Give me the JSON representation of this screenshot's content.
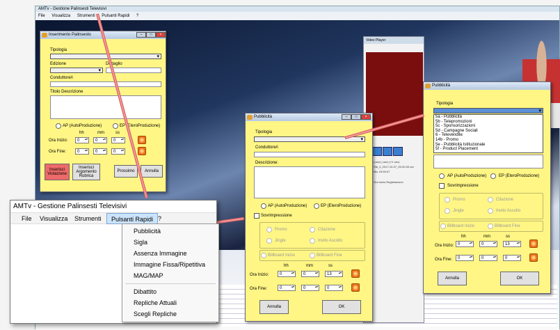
{
  "background_app": {
    "title": "AMTv - Gestione Palinsesti Televisivi",
    "menu": [
      "File",
      "Visualizza",
      "Strumenti",
      "Pulsanti Rapidi",
      "?"
    ]
  },
  "video_player": {
    "title": "Video Player",
    "info_line1": "Rai_3_2017-10-07_00-00-09.avi",
    "info_line2": "Ma: 23:59:47",
    "info_line3": "Ora Inizio Registrazione",
    "links": [
      "(-sec)",
      "(-sec)",
      "(+1 sec)"
    ]
  },
  "inserimento_window": {
    "title": "Inserimento Palinsesto",
    "tipologia_label": "Tipologia",
    "edizione_label": "Edizione",
    "dettaglio_label": "Dettaglio",
    "conduttore_label": "Conduttore/i",
    "titolo_label": "Titolo Descrizione",
    "radio_ap": "AP (AutoProduzione)",
    "radio_ep": "EP (EteroProduzione)",
    "hh": "hh",
    "mm": "mm",
    "ss": "ss",
    "ora_inizio": "Ora Inizio:",
    "ora_fine": "Ora Fine:",
    "time_zero": "0",
    "btn_violazione": "Inserisci Violazione",
    "btn_argomento": "Inserisci Argomento Rubrica",
    "btn_prossimo": "Prossimo",
    "btn_annulla": "Annulla"
  },
  "pubblicita_window": {
    "title": "Pubblicità",
    "tipologia_label": "Tipologia",
    "conduttore_label": "Conduttore/i",
    "descrizione_label": "Descrizione:",
    "radio_ap": "AP (AutoProduzione)",
    "radio_ep": "EP (EteroProduzione)",
    "sovrimpressione": "Sovrimpressione",
    "promo": "Promo",
    "citazione": "Citazione",
    "jingle": "Jingle",
    "invito_ascolto": "Invito Ascolto",
    "billboard_inizio": "Billboard Inizio",
    "billboard_fine": "Billboard Fine",
    "hh": "hh",
    "mm": "mm",
    "ss": "ss",
    "ora_inizio": "Ora Inizio:",
    "ora_fine": "Ora Fine:",
    "inizio_values": [
      "0",
      "0",
      "13"
    ],
    "fine_values": [
      "0",
      "0",
      "0"
    ],
    "btn_annulla": "Annulla",
    "btn_ok": "OK"
  },
  "pubblicita_window_2": {
    "title": "Pubblicità",
    "tipologia_label": "Tipologia",
    "tipologia_options": [
      "5a - Pubblicità",
      "5b - Telepromozioni",
      "5c - Sponsorizzazioni",
      "5d - Campagne Sociali",
      "6 - Televendite",
      "14b - Promo",
      "5e - Pubblicità Istituzionale",
      "5f - Product Placement"
    ],
    "radio_ap": "AP (AutoProduzione)",
    "radio_ep": "EP (EteroProduzione)",
    "sovrimpressione": "Sovrimpressione",
    "promo": "Promo",
    "citazione": "Citazione",
    "jingle": "Jingle",
    "invito_ascolto": "Invito Ascolto",
    "billboard_inizio": "Billboard Inizio",
    "billboard_fine": "Billboard Fine",
    "hh": "hh",
    "mm": "mm",
    "ss": "ss",
    "ora_inizio": "Ora Inizio:",
    "ora_fine": "Ora Fine:",
    "inizio_values": [
      "0",
      "0",
      "13"
    ],
    "fine_values": [
      "0",
      "0",
      "0"
    ],
    "btn_annulla": "Annulla",
    "btn_ok": "OK"
  },
  "menu_window": {
    "title": "AMTv - Gestione Palinsesti Televisivi",
    "menu": [
      "File",
      "Visualizza",
      "Strumenti",
      "Pulsanti Rapidi",
      "?"
    ],
    "dropdown_group1": [
      "Pubblicità",
      "Sigla",
      "Assenza Immagine",
      "Immagine Fissa/Ripetitiva",
      "MAG/MAP"
    ],
    "dropdown_group2": [
      "Dibattito",
      "Repliche Attuali",
      "Scegli Repliche"
    ]
  },
  "colors": {
    "form_yellow": "#fff685",
    "arrow": "#f49a9a",
    "menu_highlight": "#cce4fb"
  }
}
